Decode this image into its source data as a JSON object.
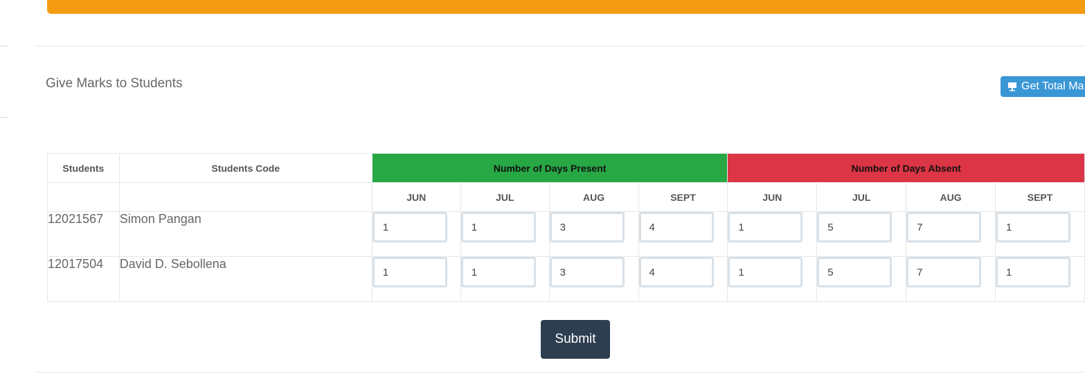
{
  "header": {
    "title": "Give Marks to Students",
    "total_button_label": "Get Total Ma"
  },
  "table": {
    "col_students": "Students",
    "col_students_code": "Students Code",
    "group_present": "Number of Days Present",
    "group_absent": "Number of Days Absent",
    "months": [
      "JUN",
      "JUL",
      "AUG",
      "SEPT"
    ],
    "rows": [
      {
        "code": "12021567",
        "name": "Simon Pangan",
        "present": [
          "1",
          "1",
          "3",
          "4"
        ],
        "absent": [
          "1",
          "5",
          "7",
          "1"
        ]
      },
      {
        "code": "12017504",
        "name": "David D. Sebollena",
        "present": [
          "1",
          "1",
          "3",
          "4"
        ],
        "absent": [
          "1",
          "5",
          "7",
          "1"
        ]
      }
    ]
  },
  "actions": {
    "submit_label": "Submit"
  },
  "colors": {
    "accent_orange": "#f39c12",
    "present_green": "#28a745",
    "absent_red": "#dc3545",
    "submit_dark": "#2c3e50",
    "info_blue": "#3a97d6"
  }
}
